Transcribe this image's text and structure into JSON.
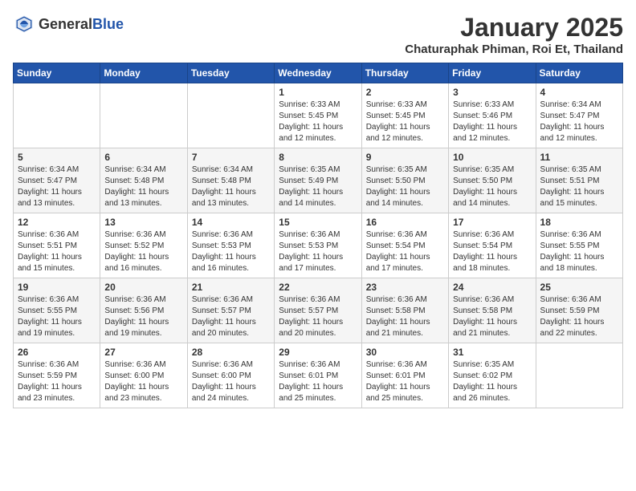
{
  "header": {
    "logo_general": "General",
    "logo_blue": "Blue",
    "month": "January 2025",
    "location": "Chaturaphak Phiman, Roi Et, Thailand"
  },
  "weekdays": [
    "Sunday",
    "Monday",
    "Tuesday",
    "Wednesday",
    "Thursday",
    "Friday",
    "Saturday"
  ],
  "weeks": [
    [
      {
        "day": "",
        "info": ""
      },
      {
        "day": "",
        "info": ""
      },
      {
        "day": "",
        "info": ""
      },
      {
        "day": "1",
        "info": "Sunrise: 6:33 AM\nSunset: 5:45 PM\nDaylight: 11 hours and 12 minutes."
      },
      {
        "day": "2",
        "info": "Sunrise: 6:33 AM\nSunset: 5:45 PM\nDaylight: 11 hours and 12 minutes."
      },
      {
        "day": "3",
        "info": "Sunrise: 6:33 AM\nSunset: 5:46 PM\nDaylight: 11 hours and 12 minutes."
      },
      {
        "day": "4",
        "info": "Sunrise: 6:34 AM\nSunset: 5:47 PM\nDaylight: 11 hours and 12 minutes."
      }
    ],
    [
      {
        "day": "5",
        "info": "Sunrise: 6:34 AM\nSunset: 5:47 PM\nDaylight: 11 hours and 13 minutes."
      },
      {
        "day": "6",
        "info": "Sunrise: 6:34 AM\nSunset: 5:48 PM\nDaylight: 11 hours and 13 minutes."
      },
      {
        "day": "7",
        "info": "Sunrise: 6:34 AM\nSunset: 5:48 PM\nDaylight: 11 hours and 13 minutes."
      },
      {
        "day": "8",
        "info": "Sunrise: 6:35 AM\nSunset: 5:49 PM\nDaylight: 11 hours and 14 minutes."
      },
      {
        "day": "9",
        "info": "Sunrise: 6:35 AM\nSunset: 5:50 PM\nDaylight: 11 hours and 14 minutes."
      },
      {
        "day": "10",
        "info": "Sunrise: 6:35 AM\nSunset: 5:50 PM\nDaylight: 11 hours and 14 minutes."
      },
      {
        "day": "11",
        "info": "Sunrise: 6:35 AM\nSunset: 5:51 PM\nDaylight: 11 hours and 15 minutes."
      }
    ],
    [
      {
        "day": "12",
        "info": "Sunrise: 6:36 AM\nSunset: 5:51 PM\nDaylight: 11 hours and 15 minutes."
      },
      {
        "day": "13",
        "info": "Sunrise: 6:36 AM\nSunset: 5:52 PM\nDaylight: 11 hours and 16 minutes."
      },
      {
        "day": "14",
        "info": "Sunrise: 6:36 AM\nSunset: 5:53 PM\nDaylight: 11 hours and 16 minutes."
      },
      {
        "day": "15",
        "info": "Sunrise: 6:36 AM\nSunset: 5:53 PM\nDaylight: 11 hours and 17 minutes."
      },
      {
        "day": "16",
        "info": "Sunrise: 6:36 AM\nSunset: 5:54 PM\nDaylight: 11 hours and 17 minutes."
      },
      {
        "day": "17",
        "info": "Sunrise: 6:36 AM\nSunset: 5:54 PM\nDaylight: 11 hours and 18 minutes."
      },
      {
        "day": "18",
        "info": "Sunrise: 6:36 AM\nSunset: 5:55 PM\nDaylight: 11 hours and 18 minutes."
      }
    ],
    [
      {
        "day": "19",
        "info": "Sunrise: 6:36 AM\nSunset: 5:55 PM\nDaylight: 11 hours and 19 minutes."
      },
      {
        "day": "20",
        "info": "Sunrise: 6:36 AM\nSunset: 5:56 PM\nDaylight: 11 hours and 19 minutes."
      },
      {
        "day": "21",
        "info": "Sunrise: 6:36 AM\nSunset: 5:57 PM\nDaylight: 11 hours and 20 minutes."
      },
      {
        "day": "22",
        "info": "Sunrise: 6:36 AM\nSunset: 5:57 PM\nDaylight: 11 hours and 20 minutes."
      },
      {
        "day": "23",
        "info": "Sunrise: 6:36 AM\nSunset: 5:58 PM\nDaylight: 11 hours and 21 minutes."
      },
      {
        "day": "24",
        "info": "Sunrise: 6:36 AM\nSunset: 5:58 PM\nDaylight: 11 hours and 21 minutes."
      },
      {
        "day": "25",
        "info": "Sunrise: 6:36 AM\nSunset: 5:59 PM\nDaylight: 11 hours and 22 minutes."
      }
    ],
    [
      {
        "day": "26",
        "info": "Sunrise: 6:36 AM\nSunset: 5:59 PM\nDaylight: 11 hours and 23 minutes."
      },
      {
        "day": "27",
        "info": "Sunrise: 6:36 AM\nSunset: 6:00 PM\nDaylight: 11 hours and 23 minutes."
      },
      {
        "day": "28",
        "info": "Sunrise: 6:36 AM\nSunset: 6:00 PM\nDaylight: 11 hours and 24 minutes."
      },
      {
        "day": "29",
        "info": "Sunrise: 6:36 AM\nSunset: 6:01 PM\nDaylight: 11 hours and 25 minutes."
      },
      {
        "day": "30",
        "info": "Sunrise: 6:36 AM\nSunset: 6:01 PM\nDaylight: 11 hours and 25 minutes."
      },
      {
        "day": "31",
        "info": "Sunrise: 6:35 AM\nSunset: 6:02 PM\nDaylight: 11 hours and 26 minutes."
      },
      {
        "day": "",
        "info": ""
      }
    ]
  ]
}
